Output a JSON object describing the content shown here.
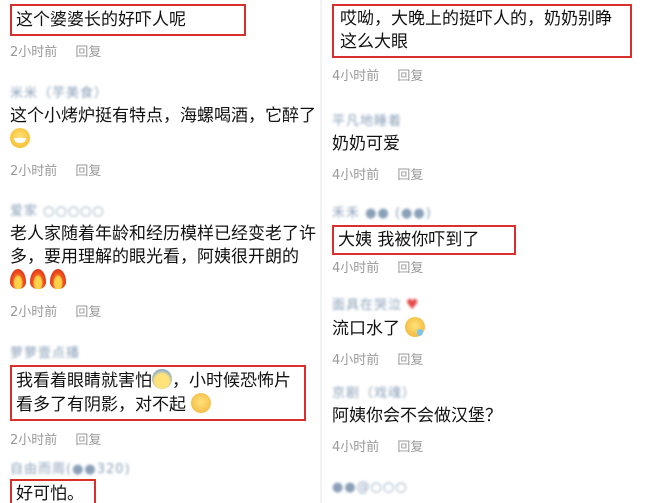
{
  "left": {
    "comments": [
      {
        "name": "",
        "text": "这个婆婆长的好吓人呢",
        "time": "2小时前",
        "reply": "回复"
      },
      {
        "name": "米米（芋美食）",
        "text": "这个小烤炉挺有特点，海螺喝酒，它醉了",
        "time": "2小时前",
        "reply": "回复"
      },
      {
        "name": "爱家 ○○○○○",
        "text": "老人家随着年龄和经历模样已经变老了许多，要用理解的眼光看，阿姨很开朗的",
        "time": "2小时前",
        "reply": "回复"
      },
      {
        "name": "萝萝壹点播",
        "text_a": "我看着眼睛就害怕",
        "text_b": "，小时候恐怖片看多了有阴影，对不起",
        "time": "2小时前",
        "reply": "回复"
      },
      {
        "name": "自由而周(●●320)",
        "text": "好可怕。"
      }
    ]
  },
  "right": {
    "comments": [
      {
        "text": "哎呦，大晚上的挺吓人的，奶奶别睁这么大眼",
        "time": "4小时前",
        "reply": "回复"
      },
      {
        "name": "平凡地睡着",
        "text": "奶奶可爱",
        "time": "4小时前",
        "reply": "回复"
      },
      {
        "name": "禾禾 ●● (●●)",
        "text": "大姨 我被你吓到了",
        "time": "4小时前",
        "reply": "回复"
      },
      {
        "name": "面具在哭泣",
        "text": "流口水了",
        "time": "4小时前",
        "reply": "回复"
      },
      {
        "name": "京剧（戏魂）",
        "text": "阿姨你会不会做汉堡？",
        "time": "4小时前",
        "reply": "回复"
      },
      {
        "name": "●●@○○○"
      }
    ]
  }
}
